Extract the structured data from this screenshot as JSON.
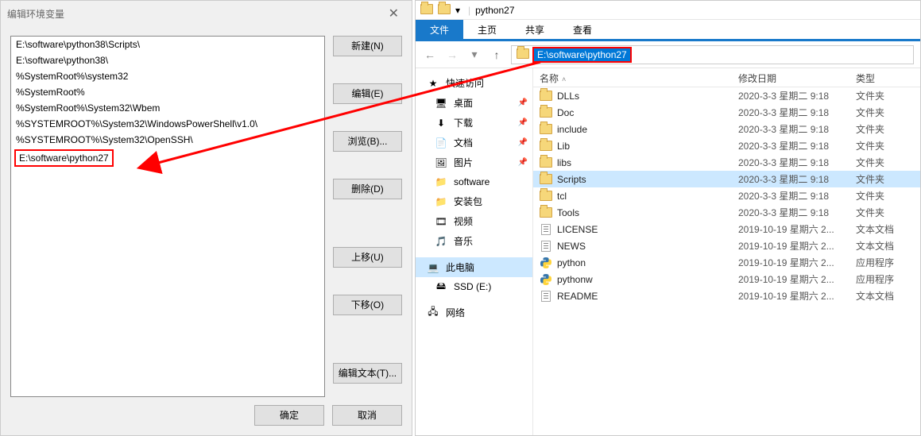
{
  "env_dialog": {
    "title": "编辑环境变量",
    "items": [
      "E:\\software\\python38\\Scripts\\",
      "E:\\software\\python38\\",
      "%SystemRoot%\\system32",
      "%SystemRoot%",
      "%SystemRoot%\\System32\\Wbem",
      "%SYSTEMROOT%\\System32\\WindowsPowerShell\\v1.0\\",
      "%SYSTEMROOT%\\System32\\OpenSSH\\",
      "E:\\software\\python27"
    ],
    "highlighted_index": 7,
    "buttons": {
      "new": "新建(N)",
      "edit": "编辑(E)",
      "browse": "浏览(B)...",
      "delete": "删除(D)",
      "up": "上移(U)",
      "down": "下移(O)",
      "edit_text": "编辑文本(T)...",
      "ok": "确定",
      "cancel": "取消"
    }
  },
  "explorer": {
    "title": "python27",
    "ribbon_tabs": {
      "file": "文件",
      "home": "主页",
      "share": "共享",
      "view": "查看"
    },
    "address": "E:\\software\\python27",
    "columns": {
      "name": "名称",
      "date": "修改日期",
      "type": "类型"
    },
    "sidebar": {
      "quick_access": "快速访问",
      "items": [
        {
          "label": "桌面",
          "pinned": true,
          "glyph": "🖥"
        },
        {
          "label": "下载",
          "pinned": true,
          "glyph": "⬇"
        },
        {
          "label": "文档",
          "pinned": true,
          "glyph": "📄"
        },
        {
          "label": "图片",
          "pinned": true,
          "glyph": "🖼"
        },
        {
          "label": "software",
          "pinned": false,
          "glyph": "📁"
        },
        {
          "label": "安装包",
          "pinned": false,
          "glyph": "📁"
        },
        {
          "label": "视频",
          "pinned": false,
          "glyph": "🎞"
        },
        {
          "label": "音乐",
          "pinned": false,
          "glyph": "🎵"
        }
      ],
      "this_pc": "此电脑",
      "ssd": "SSD (E:)",
      "network": "网络"
    },
    "files": [
      {
        "name": "DLLs",
        "date": "2020-3-3 星期二 9:18",
        "type": "文件夹",
        "kind": "folder"
      },
      {
        "name": "Doc",
        "date": "2020-3-3 星期二 9:18",
        "type": "文件夹",
        "kind": "folder"
      },
      {
        "name": "include",
        "date": "2020-3-3 星期二 9:18",
        "type": "文件夹",
        "kind": "folder"
      },
      {
        "name": "Lib",
        "date": "2020-3-3 星期二 9:18",
        "type": "文件夹",
        "kind": "folder"
      },
      {
        "name": "libs",
        "date": "2020-3-3 星期二 9:18",
        "type": "文件夹",
        "kind": "folder"
      },
      {
        "name": "Scripts",
        "date": "2020-3-3 星期二 9:18",
        "type": "文件夹",
        "kind": "folder",
        "selected": true
      },
      {
        "name": "tcl",
        "date": "2020-3-3 星期二 9:18",
        "type": "文件夹",
        "kind": "folder"
      },
      {
        "name": "Tools",
        "date": "2020-3-3 星期二 9:18",
        "type": "文件夹",
        "kind": "folder"
      },
      {
        "name": "LICENSE",
        "date": "2019-10-19 星期六 2...",
        "type": "文本文档",
        "kind": "txt"
      },
      {
        "name": "NEWS",
        "date": "2019-10-19 星期六 2...",
        "type": "文本文档",
        "kind": "txt"
      },
      {
        "name": "python",
        "date": "2019-10-19 星期六 2...",
        "type": "应用程序",
        "kind": "exe"
      },
      {
        "name": "pythonw",
        "date": "2019-10-19 星期六 2...",
        "type": "应用程序",
        "kind": "exe"
      },
      {
        "name": "README",
        "date": "2019-10-19 星期六 2...",
        "type": "文本文档",
        "kind": "txt"
      }
    ]
  }
}
